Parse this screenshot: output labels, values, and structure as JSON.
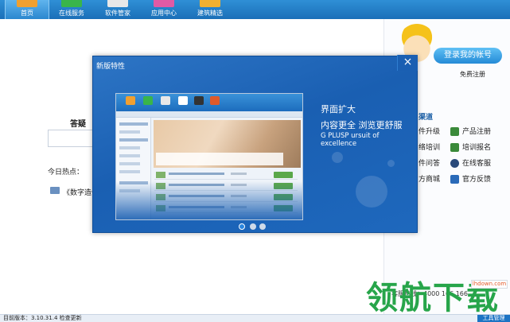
{
  "nav": {
    "items": [
      {
        "label": "首页",
        "color": "#f0a030"
      },
      {
        "label": "在线服务",
        "color": "#39b54a"
      },
      {
        "label": "软件管家",
        "color": "#e8e8e8"
      },
      {
        "label": "应用中心",
        "color": "#e05aa5"
      },
      {
        "label": "建筑精选",
        "color": "#f0b030"
      }
    ],
    "active_index": 0
  },
  "left": {
    "search_label": "答疑",
    "hot_label": "今日热点：",
    "hot_item": "《数字造价"
  },
  "right": {
    "login_button": "登录我的帐号",
    "register_link": "免费注册",
    "services_heading": "渠道",
    "services": [
      {
        "label": "件升级",
        "icon": "",
        "color": ""
      },
      {
        "label": "产品注册",
        "icon": "register-icon",
        "color": "#3a8a3a"
      },
      {
        "label": "络培训",
        "icon": "",
        "color": ""
      },
      {
        "label": "培训报名",
        "icon": "training-signup-icon",
        "color": "#3a8a3a"
      },
      {
        "label": "件问答",
        "icon": "",
        "color": ""
      },
      {
        "label": "在线客服",
        "icon": "support-icon",
        "color": "#2a4a7a"
      },
      {
        "label": "方商城",
        "icon": "",
        "color": ""
      },
      {
        "label": "官方反馈",
        "icon": "feedback-icon",
        "color": "#2a6ab8"
      }
    ]
  },
  "hotline": "客服热线：4000 166 166",
  "status": {
    "left": "目前版本：3.10.31.4  检查更新",
    "right": "工具管理"
  },
  "modal": {
    "title": "新版特性",
    "close": "×",
    "promo_line1": "界面扩大",
    "promo_line2": "内容更全  浏览更舒服",
    "promo_line3": "G PLUSP  ursuit of excellence",
    "slide_count": 3,
    "active_slide": 0
  },
  "watermark": {
    "text": "领航下载",
    "url": "lhdown.com"
  }
}
